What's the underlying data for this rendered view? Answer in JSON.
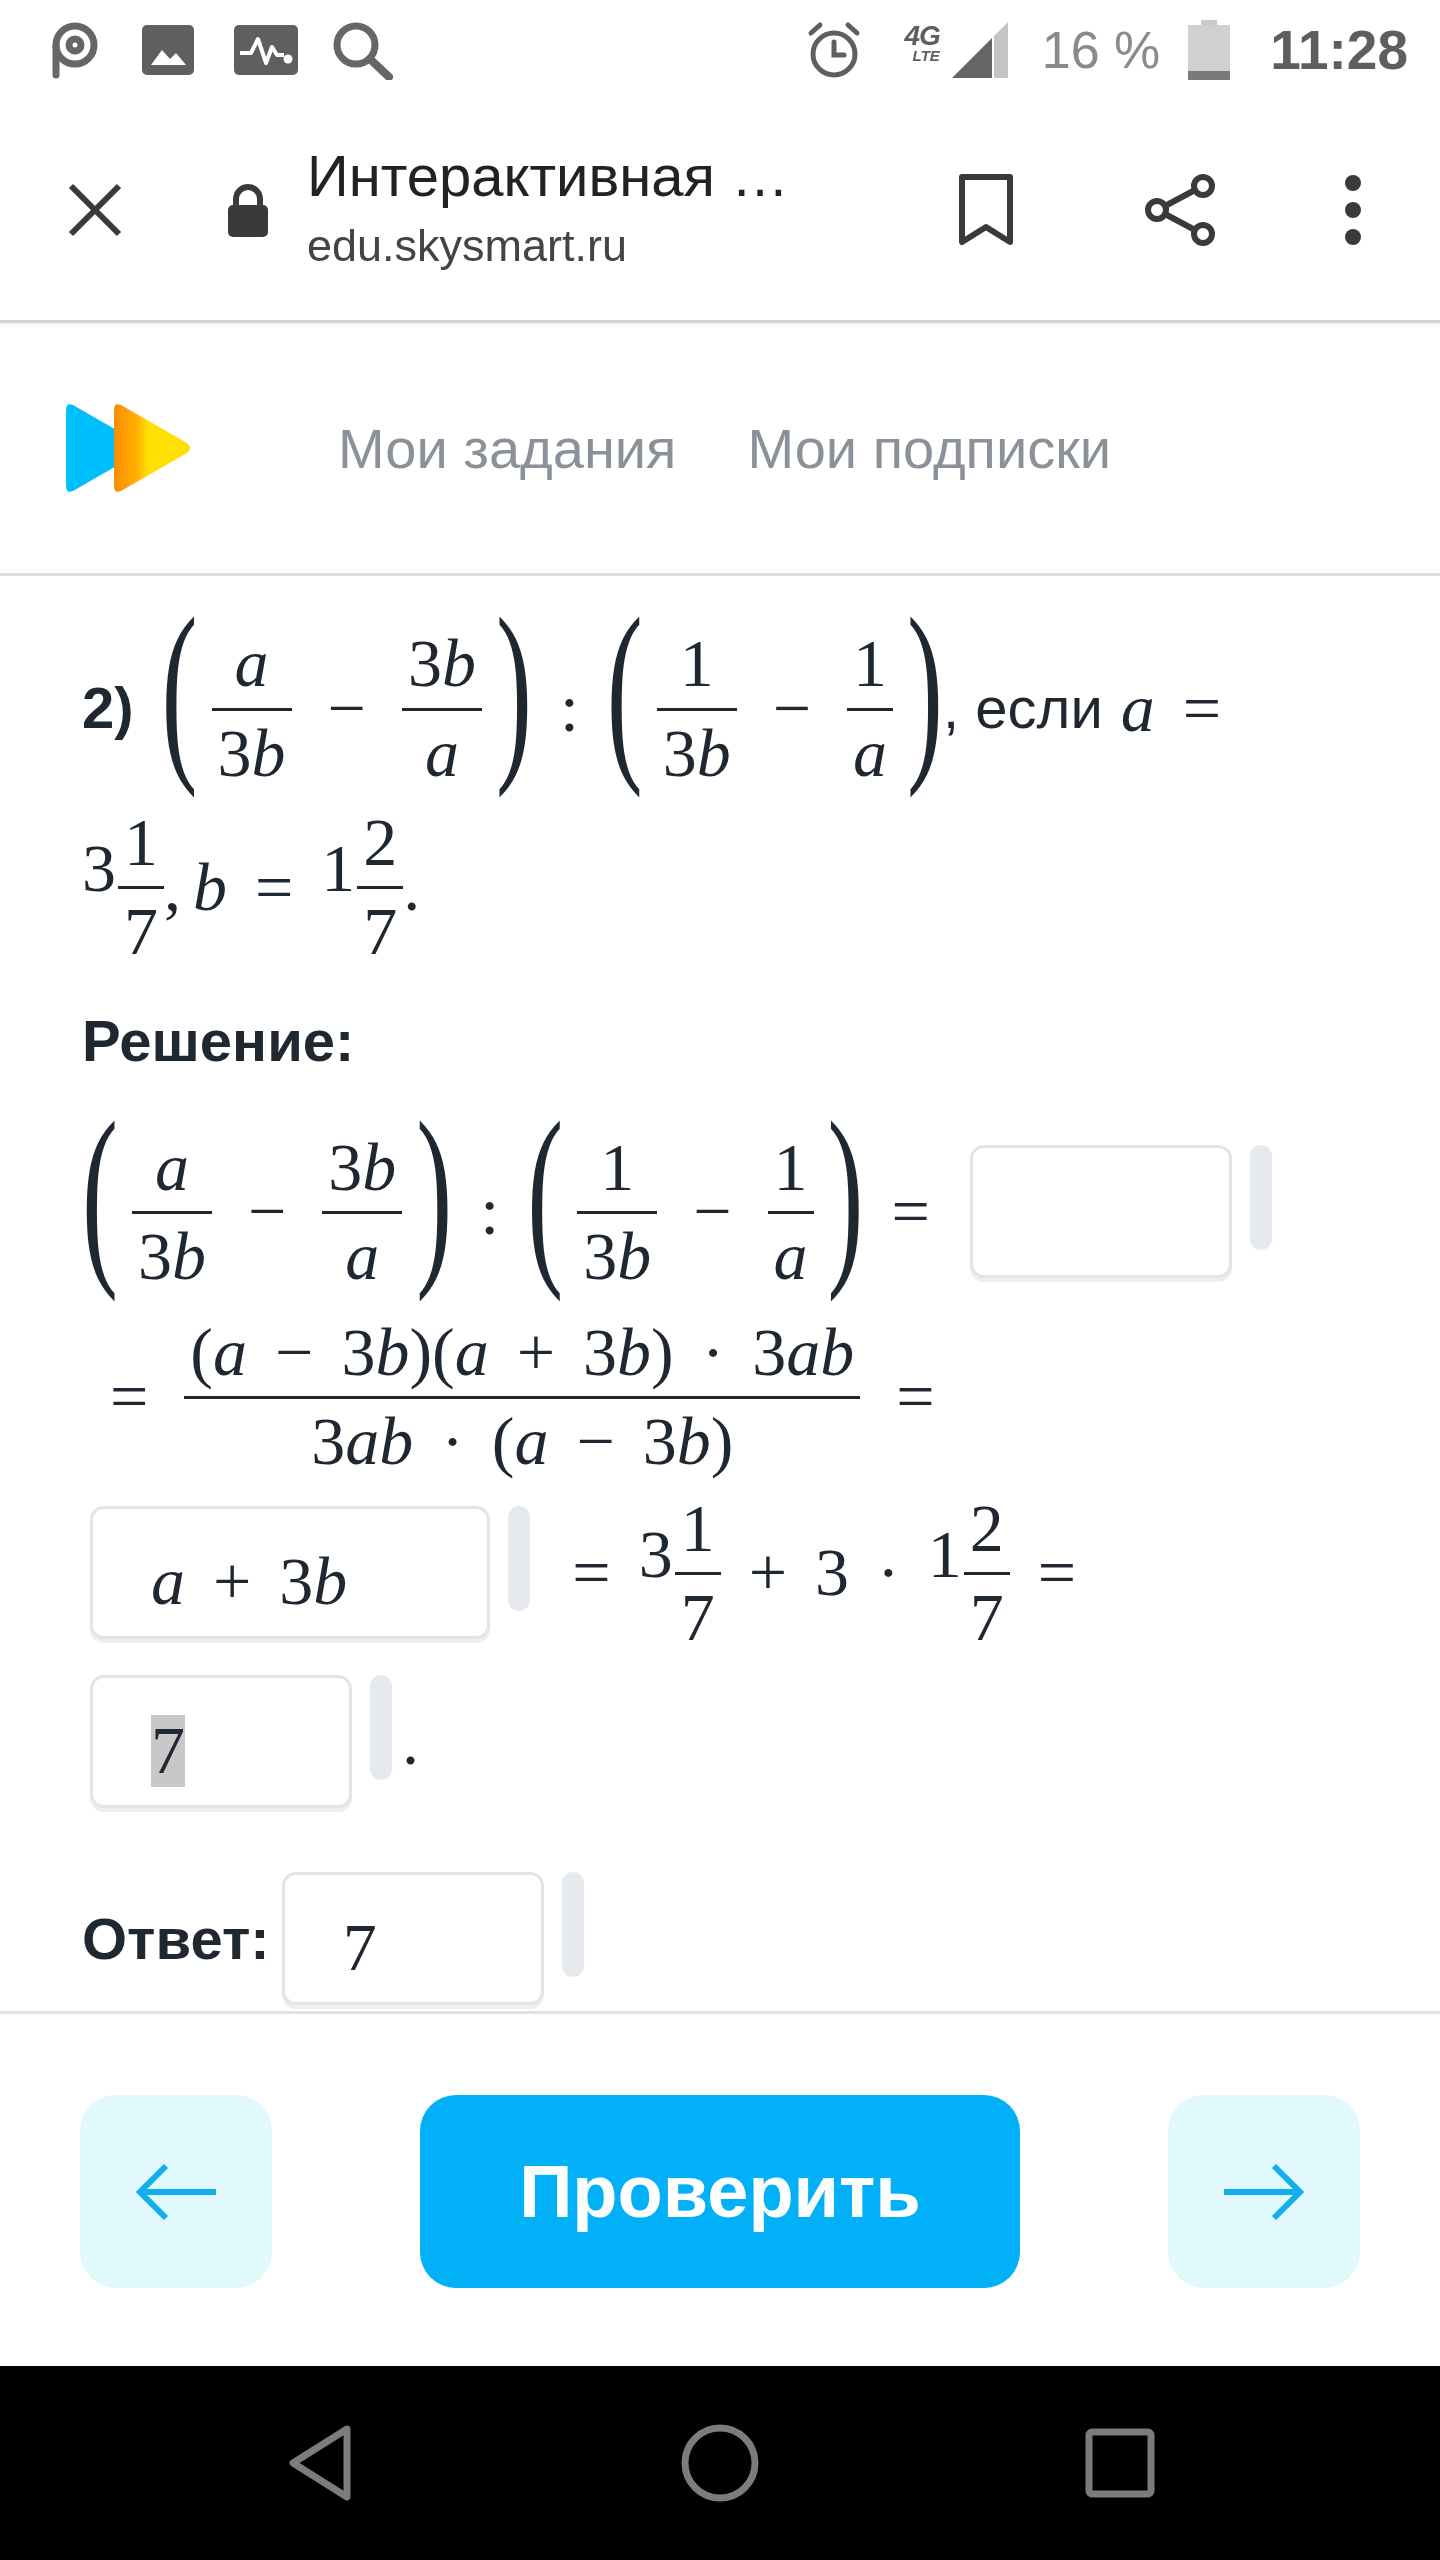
{
  "status_bar": {
    "network_generation": "4G",
    "network_technology": "LTE",
    "battery": "16 %",
    "time": "11:28"
  },
  "browser_bar": {
    "title": "Интерактивная …",
    "url": "edu.skysmart.ru"
  },
  "site_nav": [
    {
      "label": "Мои задания"
    },
    {
      "label": "Мои подписки"
    }
  ],
  "task": {
    "statement": [
      {
        "kind": "label",
        "text": "2)"
      },
      {
        "kind": "paren",
        "open": "(",
        "close": ")",
        "items": [
          {
            "kind": "frac",
            "num": [
              {
                "kind": "var",
                "text": "a"
              }
            ],
            "den": [
              {
                "kind": "num",
                "text": "3"
              },
              {
                "kind": "var",
                "text": "b"
              }
            ]
          },
          {
            "kind": "op",
            "text": "−"
          },
          {
            "kind": "frac",
            "num": [
              {
                "kind": "num",
                "text": "3"
              },
              {
                "kind": "var",
                "text": "b"
              }
            ],
            "den": [
              {
                "kind": "var",
                "text": "a"
              }
            ]
          }
        ]
      },
      {
        "kind": "op",
        "text": ":"
      },
      {
        "kind": "paren",
        "open": "(",
        "close": ")",
        "items": [
          {
            "kind": "frac",
            "num": [
              {
                "kind": "num",
                "text": "1"
              }
            ],
            "den": [
              {
                "kind": "num",
                "text": "3"
              },
              {
                "kind": "var",
                "text": "b"
              }
            ]
          },
          {
            "kind": "op",
            "text": "−"
          },
          {
            "kind": "frac",
            "num": [
              {
                "kind": "num",
                "text": "1"
              }
            ],
            "den": [
              {
                "kind": "var",
                "text": "a"
              }
            ]
          }
        ]
      },
      {
        "kind": "text",
        "text": ", если"
      },
      {
        "kind": "var",
        "text": "a"
      },
      {
        "kind": "op",
        "text": "="
      },
      {
        "kind": "mixed",
        "whole": "3",
        "num": "1",
        "den": "7"
      },
      {
        "kind": "punct",
        "text": ","
      },
      {
        "kind": "var",
        "text": "b"
      },
      {
        "kind": "op",
        "text": "="
      },
      {
        "kind": "mixed",
        "whole": "1",
        "num": "2",
        "den": "7"
      },
      {
        "kind": "punct",
        "text": "."
      }
    ],
    "solution": {
      "title": "Решение:",
      "lines": [
        [
          {
            "kind": "paren",
            "open": "(",
            "close": ")",
            "items": [
              {
                "kind": "frac",
                "num": [
                  {
                    "kind": "var",
                    "text": "a"
                  }
                ],
                "den": [
                  {
                    "kind": "num",
                    "text": "3"
                  },
                  {
                    "kind": "var",
                    "text": "b"
                  }
                ]
              },
              {
                "kind": "op",
                "text": "−"
              },
              {
                "kind": "frac",
                "num": [
                  {
                    "kind": "num",
                    "text": "3"
                  },
                  {
                    "kind": "var",
                    "text": "b"
                  }
                ],
                "den": [
                  {
                    "kind": "var",
                    "text": "a"
                  }
                ]
              }
            ]
          },
          {
            "kind": "op",
            "text": ":"
          },
          {
            "kind": "paren",
            "open": "(",
            "close": ")",
            "items": [
              {
                "kind": "frac",
                "num": [
                  {
                    "kind": "num",
                    "text": "1"
                  }
                ],
                "den": [
                  {
                    "kind": "num",
                    "text": "3"
                  },
                  {
                    "kind": "var",
                    "text": "b"
                  }
                ]
              },
              {
                "kind": "op",
                "text": "−"
              },
              {
                "kind": "frac",
                "num": [
                  {
                    "kind": "num",
                    "text": "1"
                  }
                ],
                "den": [
                  {
                    "kind": "var",
                    "text": "a"
                  }
                ]
              }
            ]
          },
          {
            "kind": "op",
            "text": "="
          },
          {
            "kind": "field"
          }
        ],
        [
          {
            "kind": "op",
            "text": "="
          },
          {
            "kind": "frac",
            "num": [
              {
                "kind": "delim",
                "text": "("
              },
              {
                "kind": "var",
                "text": "a"
              },
              {
                "kind": "op",
                "text": "−"
              },
              {
                "kind": "num",
                "text": "3"
              },
              {
                "kind": "var",
                "text": "b"
              },
              {
                "kind": "delim",
                "text": ")"
              },
              {
                "kind": "delim",
                "text": "("
              },
              {
                "kind": "var",
                "text": "a"
              },
              {
                "kind": "op",
                "text": "+"
              },
              {
                "kind": "num",
                "text": "3"
              },
              {
                "kind": "var",
                "text": "b"
              },
              {
                "kind": "delim",
                "text": ")"
              },
              {
                "kind": "op",
                "text": "·"
              },
              {
                "kind": "num",
                "text": "3"
              },
              {
                "kind": "var",
                "text": "ab"
              }
            ],
            "den": [
              {
                "kind": "num",
                "text": "3"
              },
              {
                "kind": "var",
                "text": "ab"
              },
              {
                "kind": "op",
                "text": "·"
              },
              {
                "kind": "delim",
                "text": "("
              },
              {
                "kind": "var",
                "text": "a"
              },
              {
                "kind": "op",
                "text": "−"
              },
              {
                "kind": "num",
                "text": "3"
              },
              {
                "kind": "var",
                "text": "b"
              },
              {
                "kind": "delim",
                "text": ")"
              }
            ]
          },
          {
            "kind": "op",
            "text": "="
          }
        ],
        [
          {
            "kind": "field",
            "value": [
              {
                "kind": "var",
                "text": "a"
              },
              {
                "kind": "op",
                "text": "+"
              },
              {
                "kind": "num",
                "text": "3"
              },
              {
                "kind": "var",
                "text": "b"
              }
            ],
            "text_selected": false
          },
          {
            "kind": "op",
            "text": "="
          },
          {
            "kind": "mixed",
            "whole": "3",
            "num": "1",
            "den": "7"
          },
          {
            "kind": "op",
            "text": "+"
          },
          {
            "kind": "num",
            "text": "3"
          },
          {
            "kind": "op",
            "text": "·"
          },
          {
            "kind": "mixed",
            "whole": "1",
            "num": "2",
            "den": "7"
          },
          {
            "kind": "op",
            "text": "="
          }
        ],
        [
          {
            "kind": "field",
            "value": [
              {
                "kind": "num",
                "text": "7"
              }
            ],
            "text_selected": true
          },
          {
            "kind": "punct",
            "text": "."
          }
        ]
      ]
    },
    "answer": {
      "label": "Ответ:",
      "field": {
        "kind": "field",
        "value": [
          {
            "kind": "num",
            "text": "7"
          }
        ],
        "text_selected": false
      }
    }
  },
  "actions": {
    "check": "Проверить"
  }
}
